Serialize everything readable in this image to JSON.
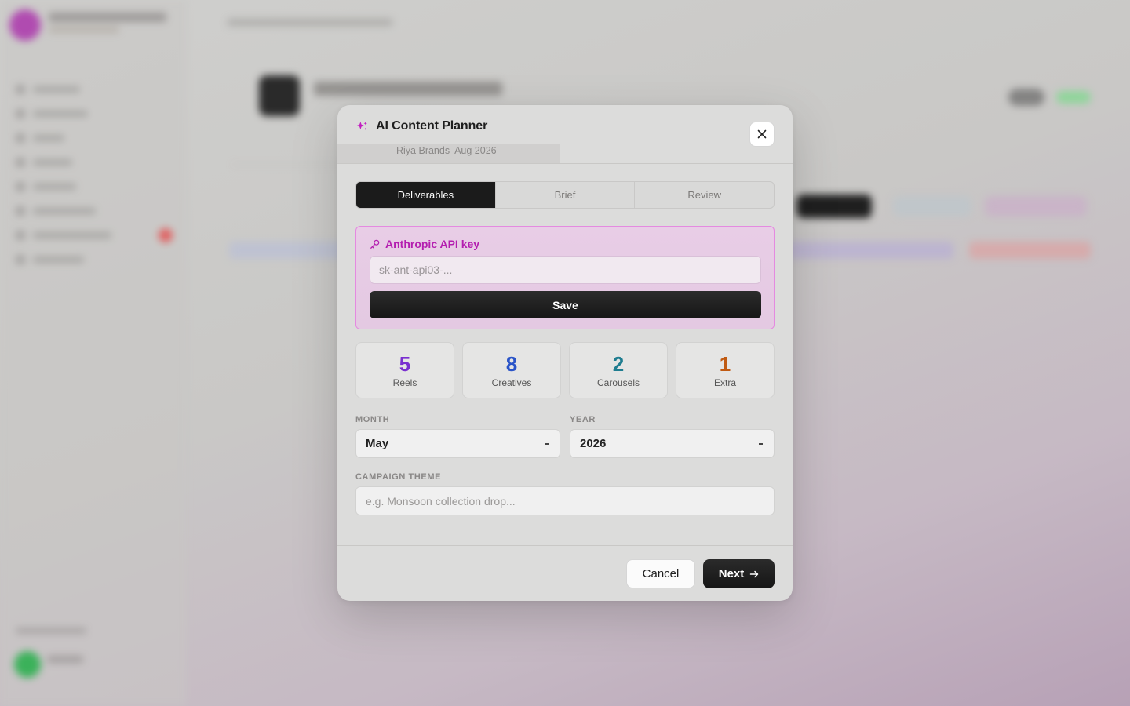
{
  "modal": {
    "title": "AI Content Planner",
    "subtitle_client": "Riya Brands",
    "subtitle_period": "Aug 2026",
    "accent_color": "#b41eb0"
  },
  "tabs": [
    {
      "label": "Deliverables",
      "active": true
    },
    {
      "label": "Brief",
      "active": false
    },
    {
      "label": "Review",
      "active": false
    }
  ],
  "api_key": {
    "label": "Anthropic API key",
    "placeholder": "sk-ant-api03-...",
    "value": "",
    "save_label": "Save"
  },
  "deliverables": [
    {
      "count": "5",
      "label": "Reels",
      "color": "#7a2fd0"
    },
    {
      "count": "8",
      "label": "Creatives",
      "color": "#2a54c8"
    },
    {
      "count": "2",
      "label": "Carousels",
      "color": "#1f7d90"
    },
    {
      "count": "1",
      "label": "Extra",
      "color": "#c05a12"
    }
  ],
  "month": {
    "label": "MONTH",
    "value": "May"
  },
  "year": {
    "label": "YEAR",
    "value": "2026"
  },
  "campaign_theme": {
    "label": "CAMPAIGN THEME",
    "placeholder": "e.g. Monsoon collection drop...",
    "value": ""
  },
  "footer": {
    "cancel_label": "Cancel",
    "next_label": "Next"
  }
}
